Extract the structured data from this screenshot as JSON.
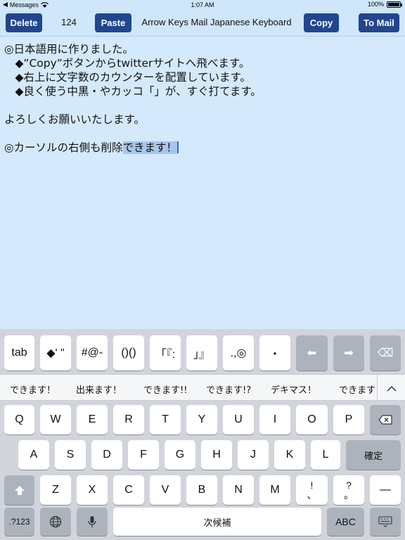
{
  "status_bar": {
    "back_app": "Messages",
    "time": "1:07 AM",
    "battery_text": "100%",
    "battery_level": 1.0
  },
  "toolbar": {
    "delete_label": "Delete",
    "char_count": "124",
    "paste_label": "Paste",
    "title": "Arrow Keys Mail Japanese Keyboard",
    "copy_label": "Copy",
    "tomail_label": "To Mail",
    "button_color": "#21468f"
  },
  "editor": {
    "lines": [
      "◎日本語用に作りました。",
      "　◆”Copy”ボタンからtwitterサイトへ飛べます。",
      "　◆右上に文字数のカウンターを配置しています。",
      "　◆良く使う中黒・やカッコ「」が、すぐ打てます。",
      "",
      "よろしくお願いいたします。",
      "",
      "◎カーソルの右側も削除"
    ],
    "selected_text": "できます！"
  },
  "keyboard": {
    "custom_row": {
      "tab": "tab",
      "diamond_quote": "◆' \"",
      "symbols": "#@-",
      "parens": "()()",
      "brackets": "「『:",
      "close_brackets": "」』",
      "punct": ".,◎",
      "middle_dot": "・",
      "left_arrow": "⬅",
      "right_arrow": "➡",
      "backspace": "⌫"
    },
    "suggestions": [
      "できます！",
      "出来ます！",
      "できます!!",
      "できます!?",
      "デキマス！",
      "できます"
    ],
    "row1": [
      "Q",
      "W",
      "E",
      "R",
      "T",
      "Y",
      "U",
      "I",
      "O",
      "P"
    ],
    "row2": [
      "A",
      "S",
      "D",
      "F",
      "G",
      "H",
      "J",
      "K",
      "L"
    ],
    "confirm": "確定",
    "row3": [
      "Z",
      "X",
      "C",
      "V",
      "B",
      "N",
      "M"
    ],
    "excl": "!\n、",
    "question": "?\n。",
    "dash": "—",
    "numbers": ".?123",
    "space": "次候補",
    "abc": "ABC"
  }
}
